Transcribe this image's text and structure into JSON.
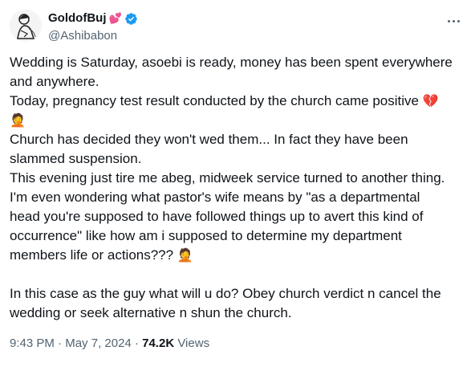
{
  "author": {
    "display_name": "GoldofBuj",
    "name_emoji": "💕",
    "handle": "@Ashibabon"
  },
  "tweet": {
    "lines": [
      "Wedding is Saturday, asoebi is ready, money has been spent everywhere",
      "and anywhere.",
      "Today, pregnancy test result conducted by the church came positive",
      "Church has decided they won't wed them... In fact they have been",
      "slammed suspension.",
      "This evening just tire me abeg, midweek service turned to another thing.",
      "I'm even wondering what pastor's wife means by \"as a departmental",
      "head you're supposed to have followed things up to avert this kind of",
      "occurrence\" like how am i supposed to determine my department",
      "members life or actions???",
      "In this case as the guy what will u do? Obey church verdict n cancel the",
      "wedding or seek alternative n shun the church."
    ],
    "emojis": {
      "broken_heart": "💔",
      "facepalm": "🤦"
    }
  },
  "meta": {
    "time": "9:43 PM",
    "separator": "·",
    "date": "May 7, 2024",
    "views_count": "74.2K",
    "views_label": "Views"
  },
  "icons": {
    "verified": "verified-badge-icon",
    "more": "more-options-icon",
    "accent": "#1d9bf0"
  }
}
